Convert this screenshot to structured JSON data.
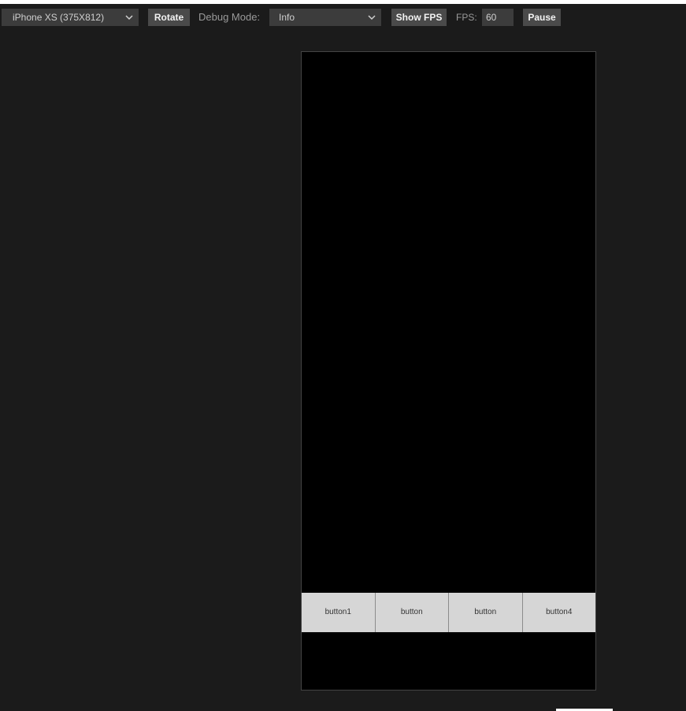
{
  "toolbar": {
    "device_select": {
      "value": "iPhone XS (375X812)",
      "icon": "chevron-down-icon"
    },
    "rotate_label": "Rotate",
    "debug_mode_label": "Debug Mode:",
    "debug_select": {
      "value": "Info",
      "icon": "chevron-down-icon"
    },
    "show_fps_label": "Show FPS",
    "fps_label": "FPS:",
    "fps_value": "60",
    "pause_label": "Pause"
  },
  "preview": {
    "buttons": [
      {
        "label": "button1"
      },
      {
        "label": "button"
      },
      {
        "label": "button"
      },
      {
        "label": "button4"
      }
    ]
  },
  "colors": {
    "background": "#1b1b1b",
    "control": "#3c3c3c",
    "button": "#4a4a4a",
    "canvas": "#000000",
    "preview_button": "#d6d6d6"
  }
}
